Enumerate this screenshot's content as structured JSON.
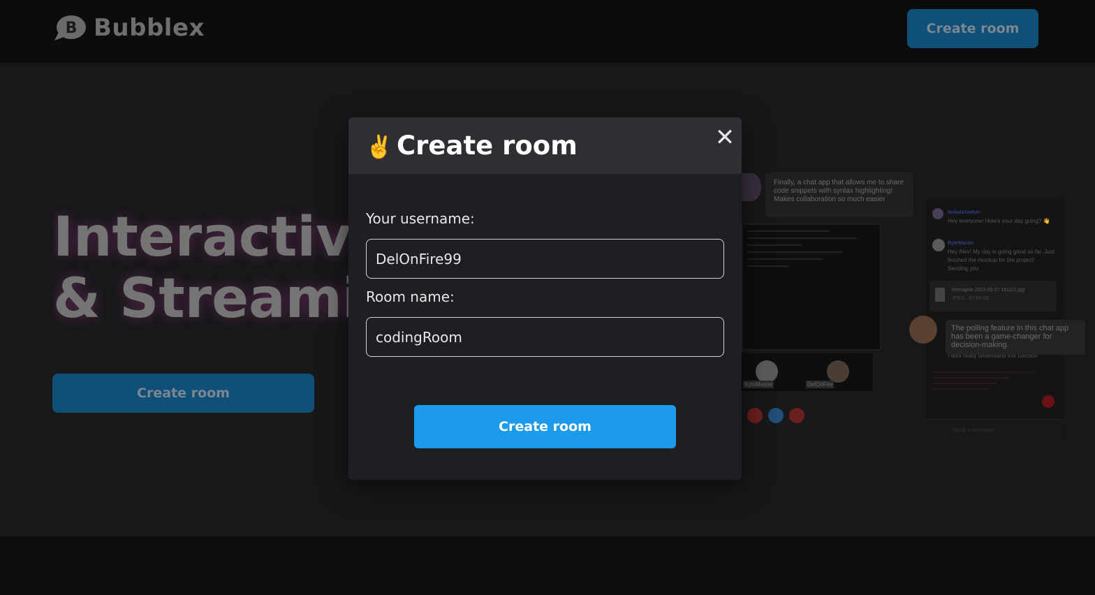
{
  "header": {
    "brand": "Bubblex",
    "logo_letter": "B",
    "create_room_label": "Create room"
  },
  "hero": {
    "title_line1": "Interactiv",
    "title_line2": "& Streami",
    "create_room_label": "Create room"
  },
  "preview": {
    "top_comment": "Finally, a chat app that allows me to share code snippets with syntax highlighting! Makes collaboration so much easier",
    "chat": [
      {
        "user": "NebulaSeeker",
        "text": "Hey everyone! How's your day going? 👋"
      },
      {
        "user": "ByteMaster",
        "text": "Hey Alex! My day is going great so far. Just finished the mockup for the project! Sending you"
      }
    ],
    "file_name": "Immagine 2023-05-27 161112.jpg",
    "file_meta": "JPEG - 67.89 KB",
    "poll_comment": "The polling feature in this chat app has been a game-changer for decision-making.",
    "reply": "I dont really understand this function",
    "tile_left": "ByteMaster",
    "tile_right": "DelOnFire",
    "input_placeholder": "Send a message"
  },
  "modal": {
    "emoji": "✌",
    "title": "Create room",
    "close_glyph": "✕",
    "username_label": "Your username:",
    "username_value": "DelOnFire99",
    "room_label": "Room name:",
    "room_value": "codingRoom",
    "submit_label": "Create room"
  },
  "colors": {
    "accent": "#1d9bea",
    "dim_button": "#0f4f78",
    "modal_bg": "#1e1f22",
    "modal_header_bg": "#2e2f32"
  }
}
